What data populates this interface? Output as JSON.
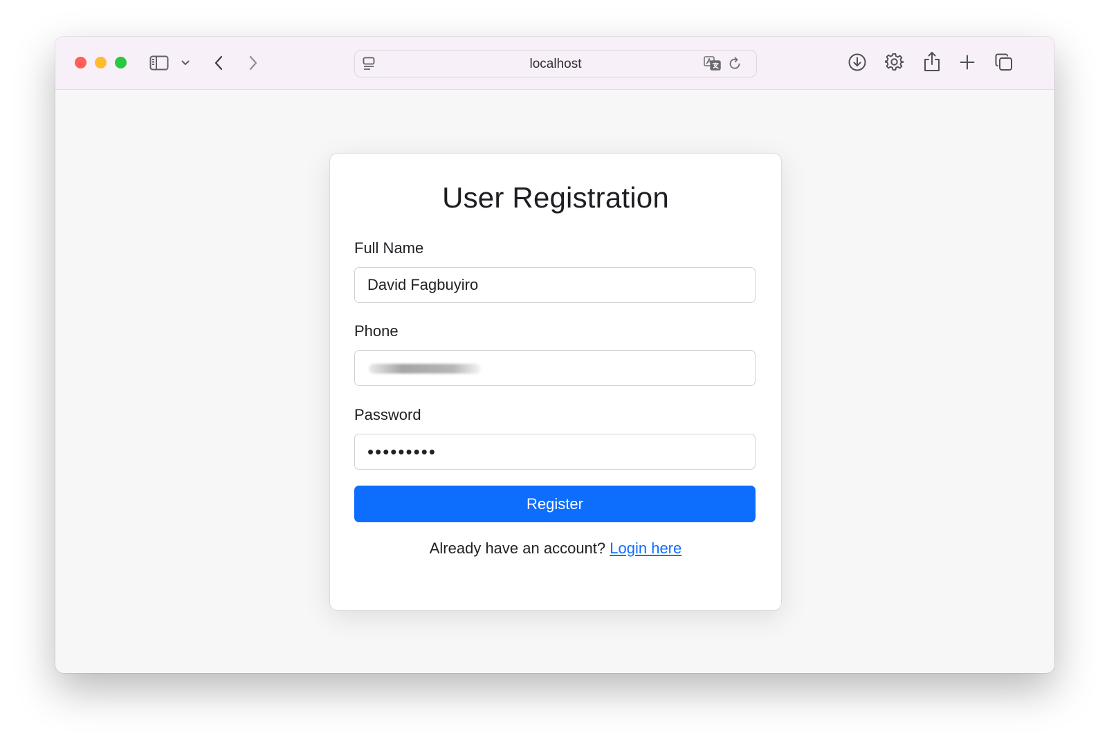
{
  "browser": {
    "url": "localhost",
    "icons": {
      "sidebar": "sidebar-icon",
      "sidebar_menu": "chevron-down-icon",
      "back": "chevron-left-icon",
      "forward": "chevron-right-icon",
      "page_menu": "page-menu-icon",
      "translate": "translate-icon",
      "reload": "reload-icon",
      "downloads": "download-icon",
      "settings": "gear-icon",
      "share": "share-icon",
      "new_tab": "plus-icon",
      "tab_overview": "tabs-overview-icon"
    },
    "traffic_colors": {
      "close": "#fe5f57",
      "minimize": "#febc2e",
      "zoom": "#28c840"
    }
  },
  "form": {
    "title": "User Registration",
    "full_name": {
      "label": "Full Name",
      "value": "David Fagbuyiro"
    },
    "phone": {
      "label": "Phone"
    },
    "password": {
      "label": "Password",
      "value": "fagbuyiro"
    },
    "submit_label": "Register",
    "footer_text": "Already have an account?",
    "login_link": "Login here"
  },
  "colors": {
    "primary": "#0d6efd",
    "page_background": "#f7f7f8",
    "toolbar_background": "#f8f0f8"
  }
}
